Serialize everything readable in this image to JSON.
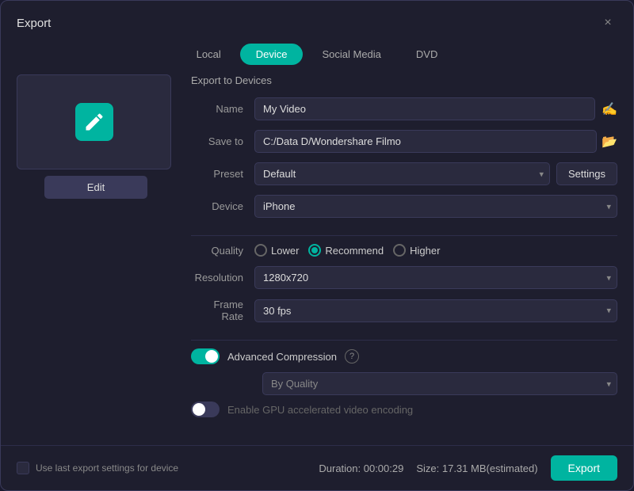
{
  "dialog": {
    "title": "Export",
    "close_label": "×"
  },
  "tabs": [
    {
      "id": "local",
      "label": "Local",
      "active": false
    },
    {
      "id": "device",
      "label": "Device",
      "active": true
    },
    {
      "id": "social_media",
      "label": "Social Media",
      "active": false
    },
    {
      "id": "dvd",
      "label": "DVD",
      "active": false
    }
  ],
  "section_title": "Export to Devices",
  "form": {
    "name_label": "Name",
    "name_value": "My Video",
    "save_to_label": "Save to",
    "save_to_value": "C:/Data D/Wondershare Filmo",
    "preset_label": "Preset",
    "preset_value": "Default",
    "device_label": "Device",
    "device_value": "iPhone",
    "quality_label": "Quality",
    "quality_options": [
      {
        "id": "lower",
        "label": "Lower",
        "selected": false
      },
      {
        "id": "recommend",
        "label": "Recommend",
        "selected": true
      },
      {
        "id": "higher",
        "label": "Higher",
        "selected": false
      }
    ],
    "resolution_label": "Resolution",
    "resolution_value": "1280x720",
    "frame_rate_label": "Frame Rate",
    "frame_rate_value": "30 fps",
    "advanced_compression_label": "Advanced Compression",
    "advanced_compression_on": true,
    "by_quality_label": "By Quality",
    "gpu_label": "Enable GPU accelerated video encoding",
    "gpu_on": false,
    "settings_label": "Settings"
  },
  "footer": {
    "checkbox_label": "Use last export settings for device",
    "duration_label": "Duration: 00:00:29",
    "size_label": "Size: 17.31 MB(estimated)",
    "export_label": "Export"
  },
  "icons": {
    "ai": "✍",
    "folder": "📁",
    "chevron": "▾",
    "help": "?",
    "edit": "Edit",
    "pen": "✎"
  }
}
